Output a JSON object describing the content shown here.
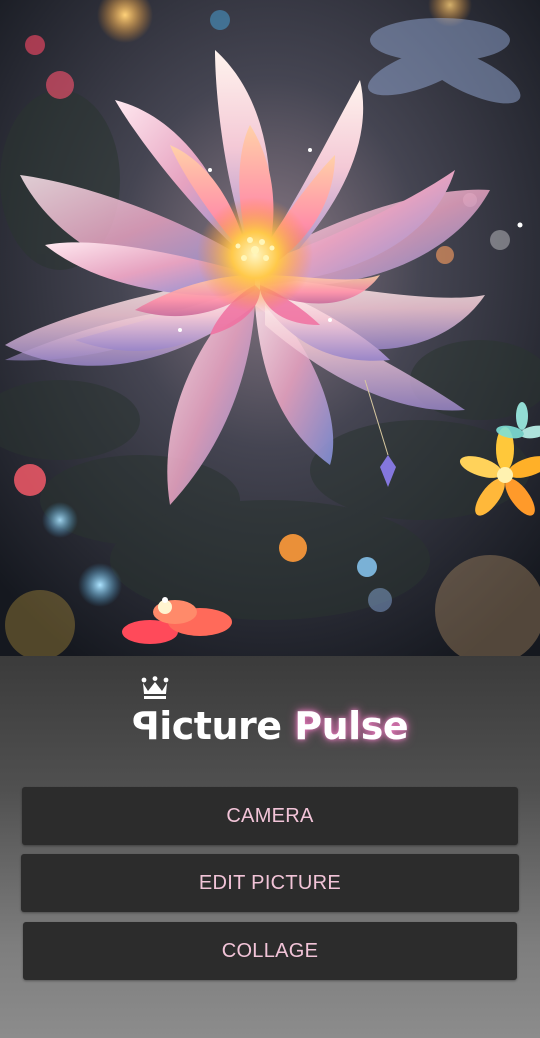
{
  "app": {
    "logo_text_prefix": "ꟼicture",
    "logo_text_strong": "Pulse",
    "crown_icon": "crown-icon"
  },
  "hero": {
    "image_description_icon": "lotus-artwork"
  },
  "buttons": {
    "camera": "CAMERA",
    "edit_picture": "EDIT PICTURE",
    "collage": "COLLAGE"
  },
  "colors": {
    "button_bg": "#2c2c2c",
    "button_text": "#f2c4d8",
    "panel_top": "#3b3b3b",
    "panel_bottom": "#8c8c8c",
    "logo_glow": "#ff78c8"
  }
}
